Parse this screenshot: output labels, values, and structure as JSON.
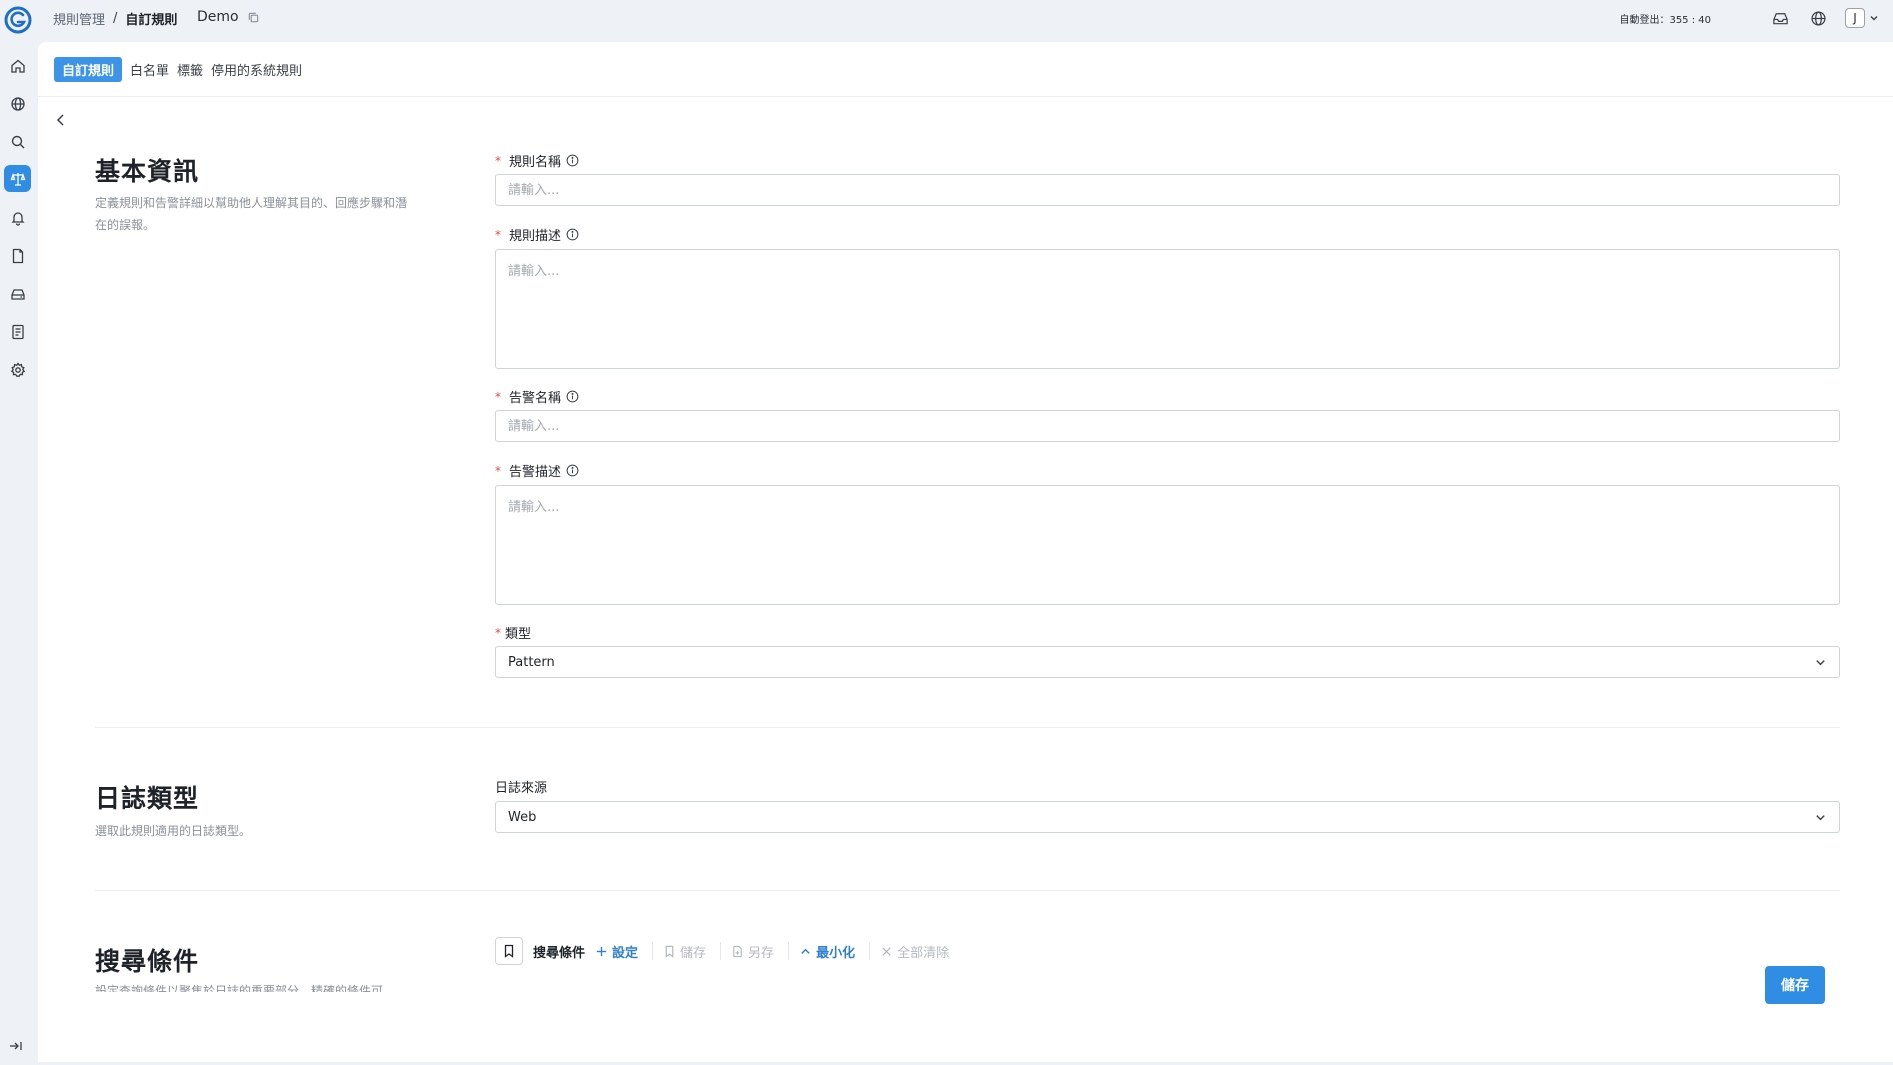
{
  "breadcrumb": {
    "parent": "規則管理",
    "separator": "/",
    "current": "自訂規則"
  },
  "header": {
    "title": "Demo",
    "timer_label": "自動登出：",
    "timer_value": "355 : 40",
    "avatar_initial": "J"
  },
  "tabs": [
    {
      "label": "自訂規則",
      "active": true
    },
    {
      "label": "白名單",
      "active": false
    },
    {
      "label": "標籤",
      "active": false
    },
    {
      "label": "停用的系統規則",
      "active": false
    }
  ],
  "sections": {
    "basic": {
      "title": "基本資訊",
      "description": "定義規則和告警詳細以幫助他人理解其目的、回應步驟和潛在的誤報。"
    },
    "log_type": {
      "title": "日誌類型",
      "description": "選取此規則適用的日誌類型。"
    },
    "search": {
      "title": "搜尋條件",
      "description": "設定查詢條件以聚焦於日誌的重要部分，精確的條件可"
    }
  },
  "fields": {
    "rule_name": {
      "label": "規則名稱",
      "required": true,
      "placeholder": "請輸入..."
    },
    "rule_description": {
      "label": "規則描述",
      "required": true,
      "placeholder": "請輸入..."
    },
    "alert_name": {
      "label": "告警名稱",
      "required": true,
      "placeholder": "請輸入..."
    },
    "alert_description": {
      "label": "告警描述",
      "required": true,
      "placeholder": "請輸入..."
    },
    "type": {
      "label": "類型",
      "required": true,
      "value": "Pattern"
    },
    "log_source": {
      "label": "日誌來源",
      "value": "Web"
    }
  },
  "search_toolbar": {
    "label": "搜尋條件",
    "settings": "設定",
    "save": "儲存",
    "save_as": "另存",
    "minimize": "最小化",
    "clear_all": "全部清除"
  },
  "footer": {
    "save_button": "儲存"
  },
  "colors": {
    "accent": "#2f8de4",
    "required": "#e04848",
    "link": "#2f7fd1"
  },
  "icons": {
    "rail": [
      "home-icon",
      "globe-icon",
      "search-icon",
      "scale-icon",
      "bell-icon",
      "document-icon",
      "storage-icon",
      "report-icon",
      "gear-icon"
    ],
    "top": [
      "inbox-icon",
      "globe-icon",
      "chevron-down-icon"
    ]
  }
}
